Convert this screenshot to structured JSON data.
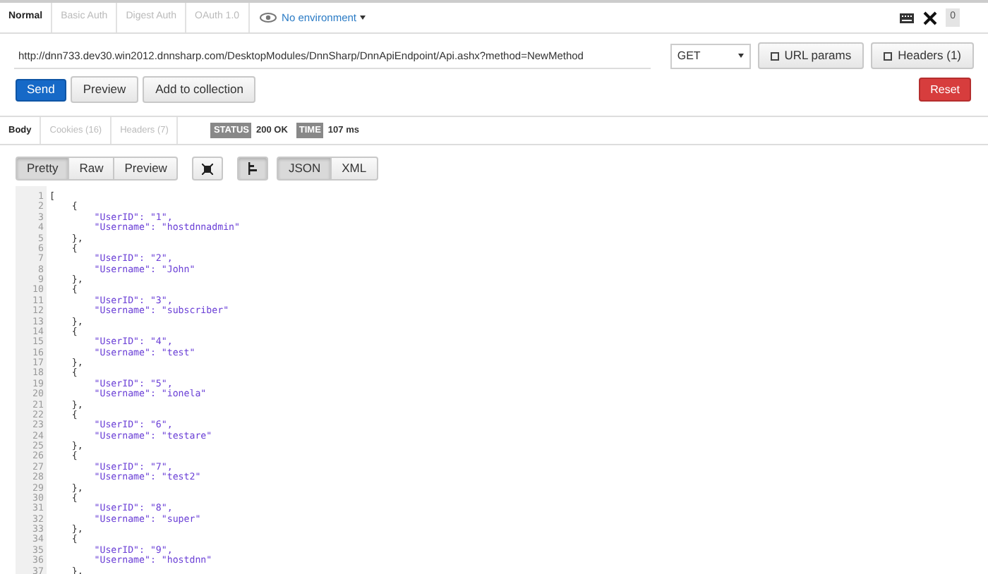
{
  "request_tabs": [
    {
      "label": "Normal",
      "selected": true
    },
    {
      "label": "Basic Auth",
      "selected": false
    },
    {
      "label": "Digest Auth",
      "selected": false
    },
    {
      "label": "OAuth 1.0",
      "selected": false
    }
  ],
  "environment": "No environment",
  "notification_count": "0",
  "url": "http://dnn733.dev30.win2012.dnnsharp.com/DesktopModules/DnnSharp/DnnApiEndpoint/Api.ashx?method=NewMethod",
  "method": "GET",
  "url_params_button": "URL params",
  "headers_button": "Headers (1)",
  "send_button": "Send",
  "preview_button": "Preview",
  "add_button": "Add to collection",
  "reset_button": "Reset",
  "response_tabs": [
    {
      "label": "Body",
      "selected": true
    },
    {
      "label": "Cookies (16)",
      "selected": false
    },
    {
      "label": "Headers (7)",
      "selected": false
    }
  ],
  "status": {
    "label": "STATUS",
    "value": "200 OK"
  },
  "time": {
    "label": "TIME",
    "value": "107 ms"
  },
  "view_modes": [
    {
      "label": "Pretty",
      "selected": true
    },
    {
      "label": "Raw",
      "selected": false
    },
    {
      "label": "Preview",
      "selected": false
    }
  ],
  "wrap_toggle": {
    "on": false
  },
  "indent_toggle": {
    "on": true
  },
  "formats": [
    {
      "label": "JSON",
      "selected": true
    },
    {
      "label": "XML",
      "selected": false
    }
  ],
  "code_lines": [
    {
      "number": "1",
      "kind": "punct",
      "text": "["
    },
    {
      "number": "2",
      "kind": "punct",
      "text": "    {"
    },
    {
      "number": "3",
      "kind": "string",
      "text": "        \"UserID\": \"1\","
    },
    {
      "number": "4",
      "kind": "string",
      "text": "        \"Username\": \"hostdnnadmin\""
    },
    {
      "number": "5",
      "kind": "punct",
      "text": "    },"
    },
    {
      "number": "6",
      "kind": "punct",
      "text": "    {"
    },
    {
      "number": "7",
      "kind": "string",
      "text": "        \"UserID\": \"2\","
    },
    {
      "number": "8",
      "kind": "string",
      "text": "        \"Username\": \"John\""
    },
    {
      "number": "9",
      "kind": "punct",
      "text": "    },"
    },
    {
      "number": "10",
      "kind": "punct",
      "text": "    {"
    },
    {
      "number": "11",
      "kind": "string",
      "text": "        \"UserID\": \"3\","
    },
    {
      "number": "12",
      "kind": "string",
      "text": "        \"Username\": \"subscriber\""
    },
    {
      "number": "13",
      "kind": "punct",
      "text": "    },"
    },
    {
      "number": "14",
      "kind": "punct",
      "text": "    {"
    },
    {
      "number": "15",
      "kind": "string",
      "text": "        \"UserID\": \"4\","
    },
    {
      "number": "16",
      "kind": "string",
      "text": "        \"Username\": \"test\""
    },
    {
      "number": "17",
      "kind": "punct",
      "text": "    },"
    },
    {
      "number": "18",
      "kind": "punct",
      "text": "    {"
    },
    {
      "number": "19",
      "kind": "string",
      "text": "        \"UserID\": \"5\","
    },
    {
      "number": "20",
      "kind": "string",
      "text": "        \"Username\": \"ionela\""
    },
    {
      "number": "21",
      "kind": "punct",
      "text": "    },"
    },
    {
      "number": "22",
      "kind": "punct",
      "text": "    {"
    },
    {
      "number": "23",
      "kind": "string",
      "text": "        \"UserID\": \"6\","
    },
    {
      "number": "24",
      "kind": "string",
      "text": "        \"Username\": \"testare\""
    },
    {
      "number": "25",
      "kind": "punct",
      "text": "    },"
    },
    {
      "number": "26",
      "kind": "punct",
      "text": "    {"
    },
    {
      "number": "27",
      "kind": "string",
      "text": "        \"UserID\": \"7\","
    },
    {
      "number": "28",
      "kind": "string",
      "text": "        \"Username\": \"test2\""
    },
    {
      "number": "29",
      "kind": "punct",
      "text": "    },"
    },
    {
      "number": "30",
      "kind": "punct",
      "text": "    {"
    },
    {
      "number": "31",
      "kind": "string",
      "text": "        \"UserID\": \"8\","
    },
    {
      "number": "32",
      "kind": "string",
      "text": "        \"Username\": \"super\""
    },
    {
      "number": "33",
      "kind": "punct",
      "text": "    },"
    },
    {
      "number": "34",
      "kind": "punct",
      "text": "    {"
    },
    {
      "number": "35",
      "kind": "string",
      "text": "        \"UserID\": \"9\","
    },
    {
      "number": "36",
      "kind": "string",
      "text": "        \"Username\": \"hostdnn\""
    },
    {
      "number": "37",
      "kind": "punct",
      "text": "    },"
    }
  ]
}
